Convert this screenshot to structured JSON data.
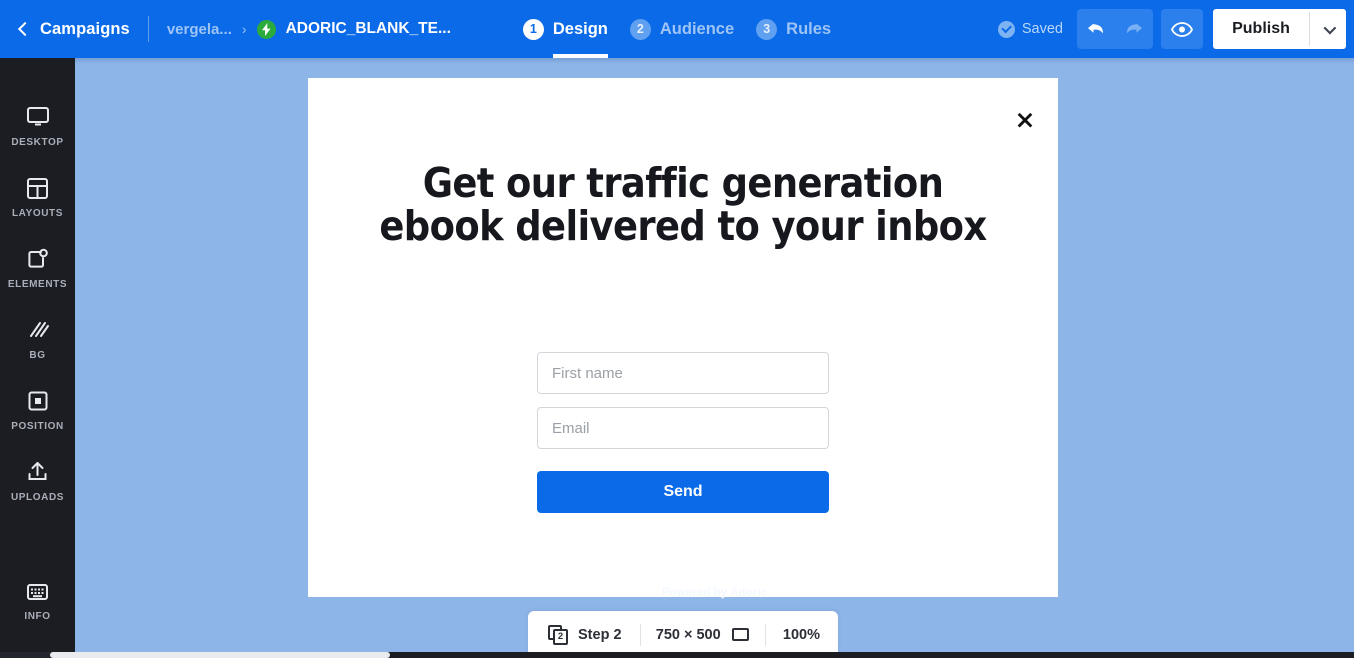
{
  "header": {
    "back_icon": "chevron-left-icon",
    "campaigns_label": "Campaigns",
    "breadcrumb_parent": "vergela...",
    "breadcrumb_separator": "›",
    "breadcrumb_badge_icon": "bolt-icon",
    "breadcrumb_current": "ADORIC_BLANK_TE...",
    "steps": [
      {
        "number": "1",
        "label": "Design",
        "active": true
      },
      {
        "number": "2",
        "label": "Audience",
        "active": false
      },
      {
        "number": "3",
        "label": "Rules",
        "active": false
      }
    ],
    "saved_label": "Saved",
    "saved_icon": "check-circle-icon",
    "undo_icon": "undo-arrow-icon",
    "redo_icon": "redo-arrow-icon",
    "preview_icon": "eye-icon",
    "publish_label": "Publish",
    "publish_caret_icon": "chevron-down-icon",
    "accent_blue": "#0a6ae8",
    "badge_green": "#2cab3d"
  },
  "sidebar": {
    "items": [
      {
        "label": "DESKTOP",
        "icon": "monitor-icon"
      },
      {
        "label": "LAYOUTS",
        "icon": "layout-grid-icon"
      },
      {
        "label": "ELEMENTS",
        "icon": "elements-icon"
      },
      {
        "label": "BG",
        "icon": "diagonal-stripes-icon"
      },
      {
        "label": "POSITION",
        "icon": "position-square-icon"
      },
      {
        "label": "UPLOADS",
        "icon": "upload-arrow-icon"
      },
      {
        "label": "INFO",
        "icon": "keyboard-icon"
      }
    ],
    "background": "#1b1d23"
  },
  "canvas": {
    "background": "#8eb5e8",
    "powered_by": "Powered by Adoric"
  },
  "popup": {
    "close_icon": "close-x-icon",
    "heading_line1": "Get our traffic generation",
    "heading_line2": "ebook delivered to your inbox",
    "fields": [
      {
        "name": "first-name",
        "value": "",
        "placeholder": "First name"
      },
      {
        "name": "email",
        "value": "",
        "placeholder": "Email"
      }
    ],
    "submit_label": "Send",
    "submit_color": "#0a6ae8"
  },
  "bottom_bar": {
    "pages_count": "2",
    "step_label": "Step 2",
    "size_label": "750 × 500",
    "size_icon": "rectangle-icon",
    "zoom_label": "100%"
  }
}
